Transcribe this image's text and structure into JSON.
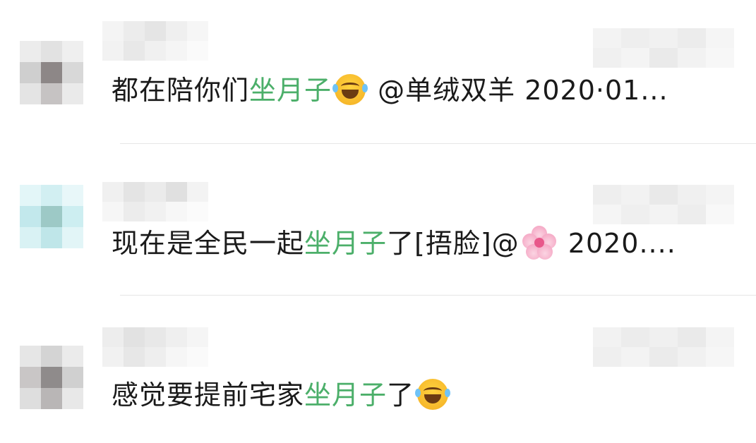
{
  "comments": [
    {
      "text_before": "都在陪你们",
      "highlight": "坐月子",
      "emoji": "face-with-tears-of-joy",
      "text_after": " @单绒双羊 2020·01..."
    },
    {
      "text_before": "现在是全民一起",
      "highlight": "坐月子",
      "text_middle": "了[捂脸]@",
      "emoji": "cherry-blossom",
      "text_after": " 2020...."
    },
    {
      "text_before": "感觉要提前宅家",
      "highlight": "坐月子",
      "text_middle": "了",
      "emoji": "face-with-tears-of-joy"
    }
  ],
  "colors": {
    "highlight": "#4caf6a",
    "text": "#1a1a1a",
    "divider": "#e6e6e6"
  }
}
